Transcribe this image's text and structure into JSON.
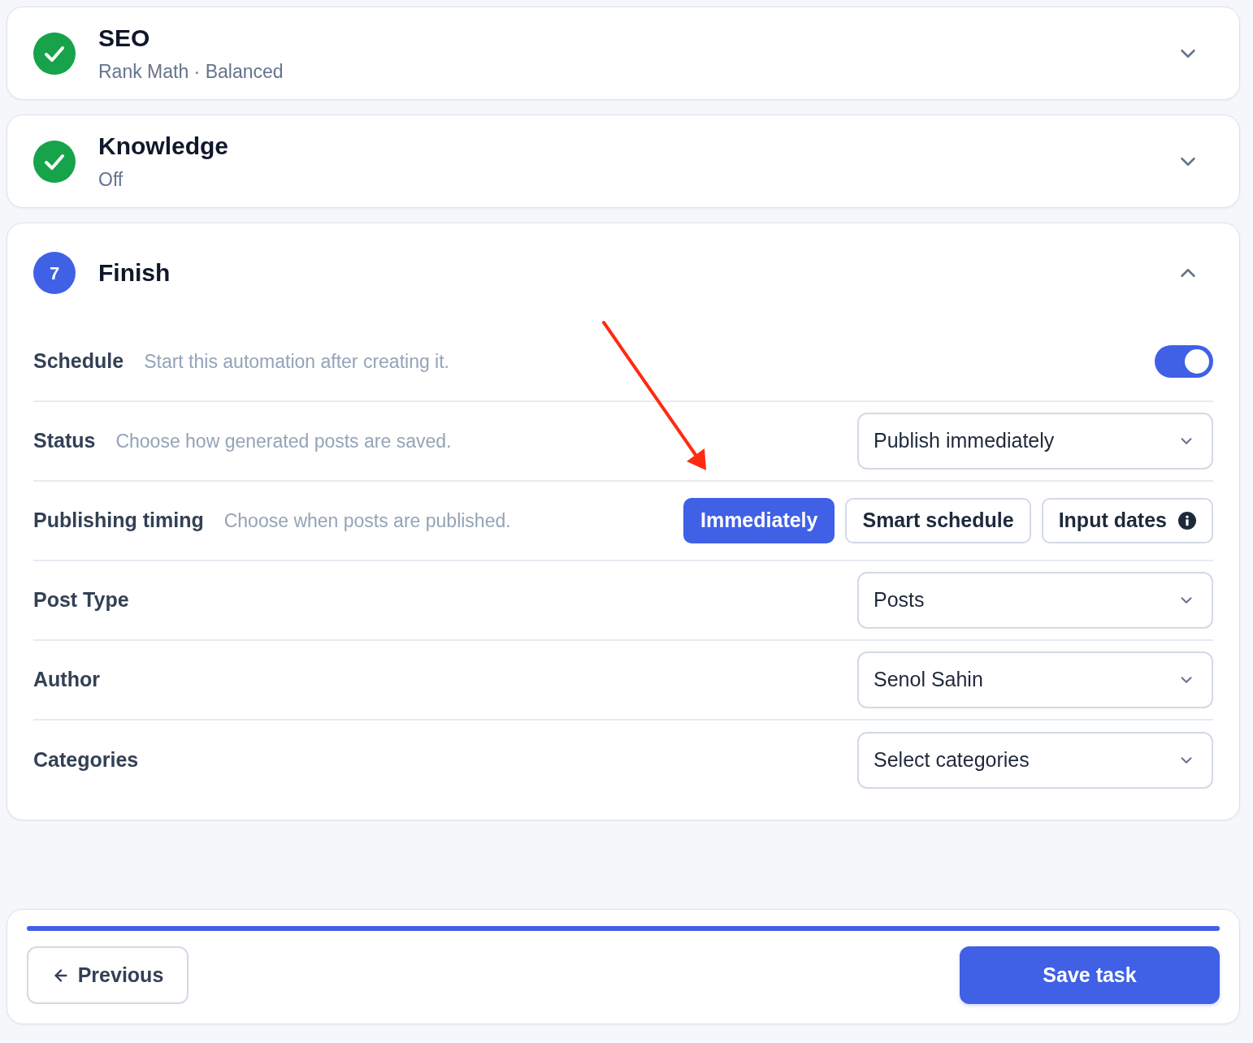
{
  "steps": [
    {
      "kind": "done",
      "title": "SEO",
      "summary": "Rank Math · Balanced",
      "expanded": false
    },
    {
      "kind": "done",
      "title": "Knowledge",
      "summary": "Off",
      "expanded": false
    },
    {
      "kind": "current",
      "number": "7",
      "title": "Finish",
      "expanded": true,
      "settings": [
        {
          "kind": "toggle",
          "label": "Schedule",
          "description": "Start this automation after creating it.",
          "on": true
        },
        {
          "kind": "select",
          "label": "Status",
          "description": "Choose how generated posts are saved.",
          "value": "Publish immediately"
        },
        {
          "kind": "segmented",
          "label": "Publishing timing",
          "description": "Choose when posts are published.",
          "options": [
            {
              "label": "Immediately",
              "selected": true,
              "info": false
            },
            {
              "label": "Smart schedule",
              "selected": false,
              "info": false
            },
            {
              "label": "Input dates",
              "selected": false,
              "info": true
            }
          ]
        },
        {
          "kind": "select",
          "label": "Post Type",
          "value": "Posts"
        },
        {
          "kind": "select",
          "label": "Author",
          "value": "Senol Sahin"
        },
        {
          "kind": "select",
          "label": "Categories",
          "value": "Select categories"
        }
      ]
    }
  ],
  "footer": {
    "progress": {
      "level": 1
    },
    "previous_button": "Previous",
    "save_button": "Save task"
  }
}
